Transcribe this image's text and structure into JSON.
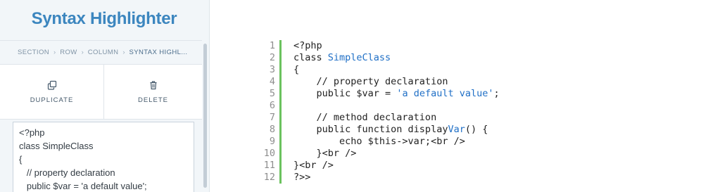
{
  "panel": {
    "title": "Syntax Highlighter",
    "breadcrumb": [
      "SECTION",
      "ROW",
      "COLUMN",
      "SYNTAX HIGHL..."
    ],
    "actions": {
      "duplicate_label": "DUPLICATE",
      "delete_label": "DELETE",
      "duplicate_icon": "duplicate-icon",
      "delete_icon": "trash-icon"
    },
    "editor_text": "<?php\nclass SimpleClass\n{\n   // property declaration\n   public $var = 'a default value';"
  },
  "preview": {
    "line_numbers": [
      "1",
      "2",
      "3",
      "4",
      "5",
      "6",
      "7",
      "8",
      "9",
      "10",
      "11",
      "12"
    ],
    "lines": [
      [
        {
          "t": "<?php"
        }
      ],
      [
        {
          "t": "class "
        },
        {
          "t": "SimpleClass",
          "c": "blue"
        }
      ],
      [
        {
          "t": "{"
        }
      ],
      [
        {
          "t": "    // property declaration"
        }
      ],
      [
        {
          "t": "    public $var = "
        },
        {
          "t": "'a default value'",
          "c": "blue"
        },
        {
          "t": ";"
        }
      ],
      [
        {
          "t": ""
        }
      ],
      [
        {
          "t": "    // method declaration"
        }
      ],
      [
        {
          "t": "    public function display"
        },
        {
          "t": "Var",
          "c": "blue"
        },
        {
          "t": "() {"
        }
      ],
      [
        {
          "t": "        echo $this->var;<br />"
        }
      ],
      [
        {
          "t": "    }<br />"
        }
      ],
      [
        {
          "t": "}<br />"
        }
      ],
      [
        {
          "t": "?>>"
        }
      ]
    ]
  },
  "colors": {
    "title": "#3c86bf",
    "panel_bg": "#f2f6f9",
    "gutter_bar": "#6bc25e",
    "highlight_blue": "#1f6fc6"
  }
}
